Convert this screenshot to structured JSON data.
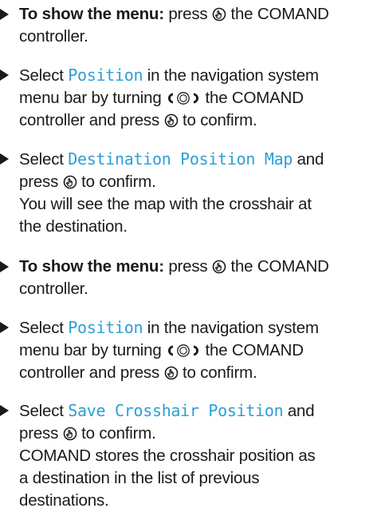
{
  "content": {
    "steps": [
      {
        "lead_bold": "To show the menu:",
        "before_icon": " press ",
        "icon": "press-controller-icon",
        "after_icon": " the COMAND",
        "line2": "controller."
      },
      {
        "pre": "Select ",
        "ui_term": "Position",
        "post": " in the navigation system",
        "line2_pre": "menu bar by turning ",
        "turn_icon": "turn-controller-icon",
        "line2_post": " the COMAND",
        "line3_pre": "controller and press ",
        "press_icon": "press-controller-icon",
        "line3_post": " to confirm."
      },
      {
        "pre": "Select ",
        "ui_term": "Destination Position Map",
        "post": " and",
        "line2_pre": "press ",
        "press_icon": "press-controller-icon",
        "line2_post": " to confirm.",
        "line3": "You will see the map with the crosshair at",
        "line4": "the destination."
      },
      {
        "lead_bold": "To show the menu:",
        "before_icon": " press ",
        "icon": "press-controller-icon",
        "after_icon": " the COMAND",
        "line2": "controller."
      },
      {
        "pre": "Select ",
        "ui_term": "Position",
        "post": " in the navigation system",
        "line2_pre": "menu bar by turning ",
        "turn_icon": "turn-controller-icon",
        "line2_post": " the COMAND",
        "line3_pre": "controller and press ",
        "press_icon": "press-controller-icon",
        "line3_post": " to confirm."
      },
      {
        "pre": "Select ",
        "ui_term": "Save Crosshair Position",
        "post": " and",
        "line2_pre": "press ",
        "press_icon": "press-controller-icon",
        "line2_post": " to confirm.",
        "line3": "COMAND stores the crosshair position as",
        "line4": "a destination in the list of previous",
        "line5": "destinations."
      }
    ],
    "colors": {
      "text": "#1a1a1a",
      "ui_term": "#2b9fd6"
    }
  }
}
